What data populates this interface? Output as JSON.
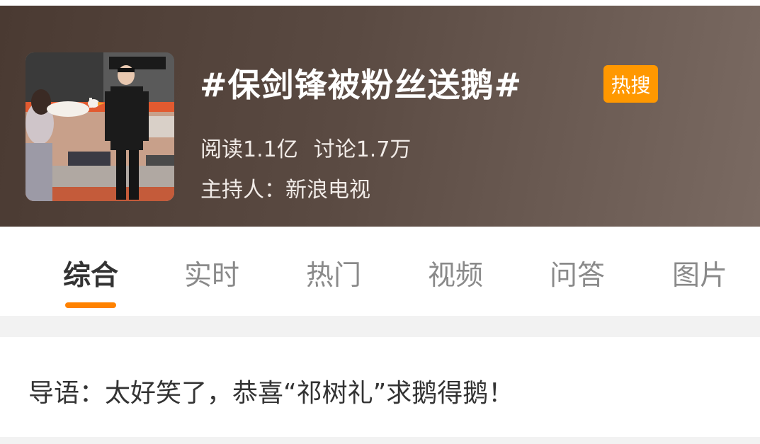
{
  "topic": {
    "title": "#保剑锋被粉丝送鹅#",
    "badge": "热搜",
    "reads": "阅读1.1亿",
    "discussions": "讨论1.7万",
    "host": "主持人：新浪电视"
  },
  "tabs": [
    {
      "label": "综合",
      "active": true
    },
    {
      "label": "实时",
      "active": false
    },
    {
      "label": "热门",
      "active": false
    },
    {
      "label": "视频",
      "active": false
    },
    {
      "label": "问答",
      "active": false
    },
    {
      "label": "图片",
      "active": false
    }
  ],
  "intro": {
    "text": "导语：太好笑了，恭喜“祁树礼”求鹅得鹅！"
  },
  "colors": {
    "accent": "#ff8200",
    "badge": "#ff9800",
    "header_bg": "#5a4a42"
  }
}
